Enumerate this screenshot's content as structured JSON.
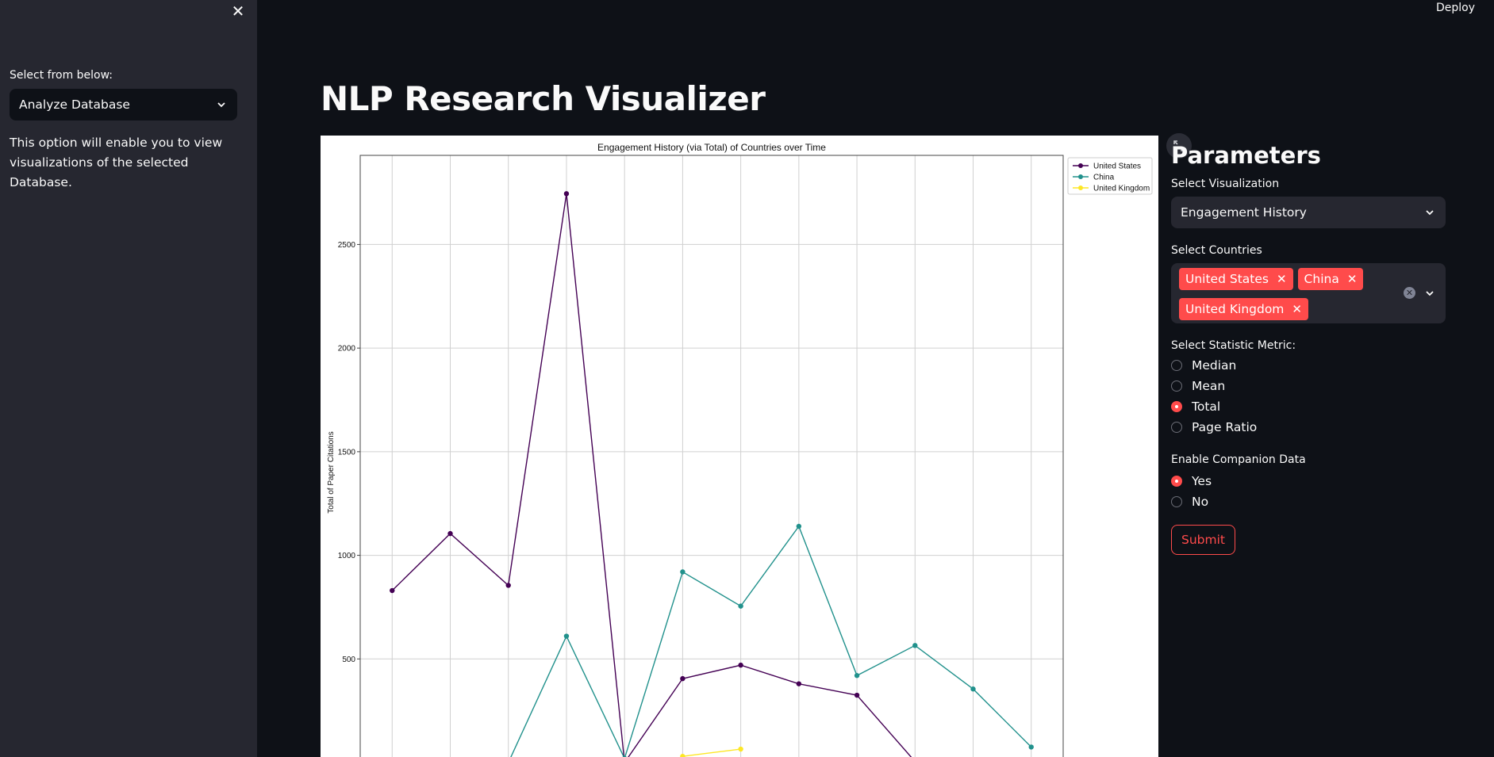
{
  "sidebar": {
    "label": "Select from below:",
    "selected": "Analyze Database",
    "description": "This option will enable you to view visualizations of the selected Database."
  },
  "header": {
    "deploy_label": "Deploy"
  },
  "main": {
    "title": "NLP Research Visualizer"
  },
  "params": {
    "heading": "Parameters",
    "visualization_label": "Select Visualization",
    "visualization_value": "Engagement History",
    "countries_label": "Select Countries",
    "countries": [
      "United States",
      "China",
      "United Kingdom"
    ],
    "metric_label": "Select Statistic Metric:",
    "metric_options": [
      "Median",
      "Mean",
      "Total",
      "Page Ratio"
    ],
    "metric_selected": "Total",
    "companion_label": "Enable Companion Data",
    "companion_options": [
      "Yes",
      "No"
    ],
    "companion_selected": "Yes",
    "submit_label": "Submit"
  },
  "colors": {
    "accent": "#ff4b4b",
    "us": "#440154",
    "china": "#21918c",
    "uk": "#fde725"
  },
  "chart_data": {
    "type": "line",
    "title": "Engagement History (via Total) of Countries over Time",
    "ylabel": "Total of Paper Citations",
    "xlabel": "",
    "x": [
      0,
      1,
      2,
      3,
      4,
      5,
      6,
      7,
      8,
      9,
      10,
      11
    ],
    "ylim": [
      -130,
      2930
    ],
    "yticks": [
      500,
      1000,
      1500,
      2000,
      2500
    ],
    "grid": true,
    "legend": "top-right",
    "series": [
      {
        "name": "United States",
        "color": "#440154",
        "points": [
          [
            0,
            830
          ],
          [
            1,
            1105
          ],
          [
            2,
            855
          ],
          [
            3,
            2745
          ],
          [
            4,
            0
          ],
          [
            5,
            405
          ],
          [
            6,
            470
          ],
          [
            7,
            380
          ],
          [
            8,
            325
          ],
          [
            9,
            5
          ],
          [
            10,
            0
          ]
        ]
      },
      {
        "name": "China",
        "color": "#21918c",
        "points": [
          [
            2,
            0
          ],
          [
            3,
            610
          ],
          [
            4,
            20
          ],
          [
            5,
            920
          ],
          [
            6,
            755
          ],
          [
            7,
            1140
          ],
          [
            8,
            420
          ],
          [
            9,
            565
          ],
          [
            10,
            355
          ],
          [
            11,
            75
          ]
        ]
      },
      {
        "name": "United Kingdom",
        "color": "#fde725",
        "points": [
          [
            5,
            30
          ],
          [
            6,
            65
          ]
        ]
      }
    ]
  }
}
